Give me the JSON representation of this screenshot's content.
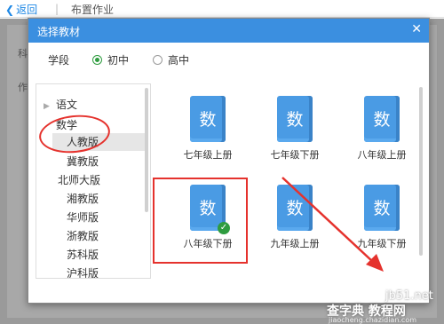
{
  "header": {
    "back_label": "返回",
    "separator": "|",
    "title": "布置作业"
  },
  "background": {
    "label1": "科",
    "label2": "作"
  },
  "modal": {
    "title": "选择教材",
    "close_glyph": "✕",
    "stage_label": "学段",
    "stage_options": [
      {
        "label": "初中",
        "checked": true
      },
      {
        "label": "高中",
        "checked": false
      }
    ]
  },
  "tree": {
    "subjects": [
      {
        "label": "语文",
        "expanded": false
      },
      {
        "label": "数学",
        "expanded": true
      }
    ],
    "editions": [
      "人教版",
      "冀教版",
      "北师大版",
      "湘教版",
      "华师版",
      "浙教版",
      "苏科版",
      "沪科版"
    ],
    "selected_edition": "人教版"
  },
  "books": [
    {
      "cover": "数",
      "label": "七年级上册",
      "selected": false
    },
    {
      "cover": "数",
      "label": "七年级下册",
      "selected": false
    },
    {
      "cover": "数",
      "label": "八年级上册",
      "selected": false
    },
    {
      "cover": "数",
      "label": "八年级下册",
      "selected": true
    },
    {
      "cover": "数",
      "label": "九年级上册",
      "selected": false
    },
    {
      "cover": "数",
      "label": "九年级下册",
      "selected": false
    }
  ],
  "watermark": {
    "line1": "jb51.net",
    "line2": "查字典 教程网",
    "line3": "jiaocheng.chazidian.com"
  },
  "colors": {
    "title_bar": "#3b8fe0",
    "book_blue": "#4a9be4",
    "annotation_red": "#e5322d",
    "check_green": "#2e9c3f"
  },
  "icons": {
    "back": "chevron-left-icon",
    "close": "close-icon",
    "collapsed": "triangle-right-icon",
    "selected": "check-circle-icon"
  }
}
